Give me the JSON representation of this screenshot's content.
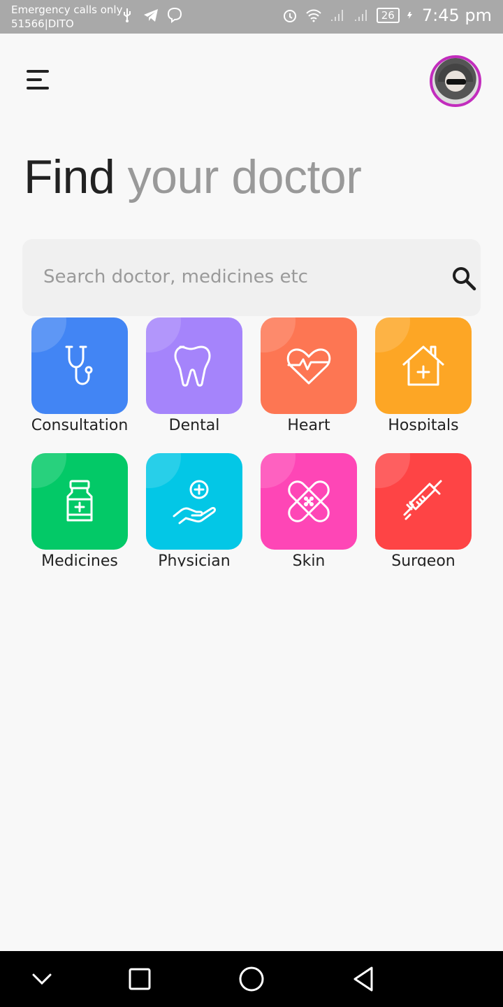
{
  "status_bar": {
    "line1": "Emergency calls only",
    "line2": "51566|DITO",
    "battery": "26",
    "time": "7:45 pm",
    "icons": [
      "usb-icon",
      "telegram-icon",
      "viber-icon",
      "alarm-icon",
      "wifi-icon",
      "signal-icon",
      "signal-icon",
      "charging-icon"
    ]
  },
  "header": {
    "menu_icon": "menu-icon",
    "avatar": "profile-avatar"
  },
  "title": {
    "part1": "Find",
    "part2": " your doctor"
  },
  "search": {
    "placeholder": "Search doctor, medicines etc",
    "value": "",
    "icon": "search-icon"
  },
  "categories": [
    {
      "label": "Consultation",
      "icon": "stethoscope-icon",
      "color": "#4285f4"
    },
    {
      "label": "Dental",
      "icon": "tooth-icon",
      "color": "#a584fb"
    },
    {
      "label": "Heart",
      "icon": "heart-pulse-icon",
      "color": "#fd7653"
    },
    {
      "label": "Hospitals",
      "icon": "hospital-icon",
      "color": "#fda625"
    },
    {
      "label": "Medicines",
      "icon": "medicine-bottle-icon",
      "color": "#03c967"
    },
    {
      "label": "Physician",
      "icon": "hand-care-icon",
      "color": "#03c7e6"
    },
    {
      "label": "Skin",
      "icon": "bandage-icon",
      "color": "#fe46b6"
    },
    {
      "label": "Surgeon",
      "icon": "syringe-icon",
      "color": "#fe4445"
    }
  ],
  "nav_bar": {
    "icons": [
      "chevron-down-icon",
      "recents-icon",
      "home-icon",
      "back-icon"
    ]
  }
}
